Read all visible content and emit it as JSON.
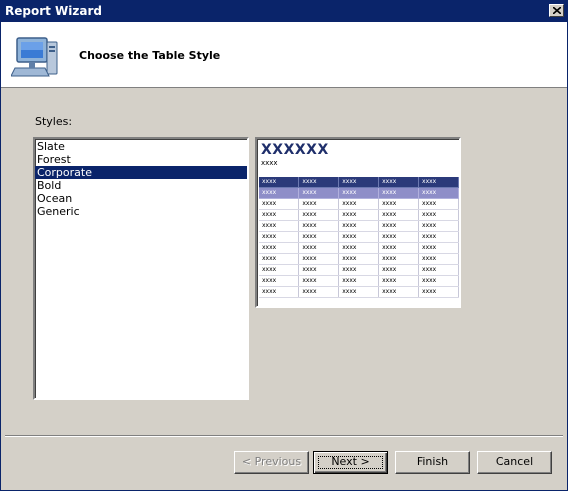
{
  "window": {
    "title": "Report Wizard"
  },
  "header": {
    "title": "Choose the Table Style",
    "icon": "computer-icon"
  },
  "styles": {
    "label": "Styles:",
    "items": [
      {
        "label": "Slate",
        "selected": false
      },
      {
        "label": "Forest",
        "selected": false
      },
      {
        "label": "Corporate",
        "selected": true
      },
      {
        "label": "Bold",
        "selected": false
      },
      {
        "label": "Ocean",
        "selected": false
      },
      {
        "label": "Generic",
        "selected": false
      }
    ]
  },
  "preview": {
    "title": "XXXXXX",
    "subtitle": "xxxx",
    "cell_text": "xxxx",
    "colors": {
      "title": "#1f2f6b",
      "header_row": "#2b3a7a",
      "selected_row": "#8e8ec8"
    }
  },
  "buttons": {
    "previous": "< Previous",
    "next": "Next >",
    "finish": "Finish",
    "cancel": "Cancel"
  }
}
